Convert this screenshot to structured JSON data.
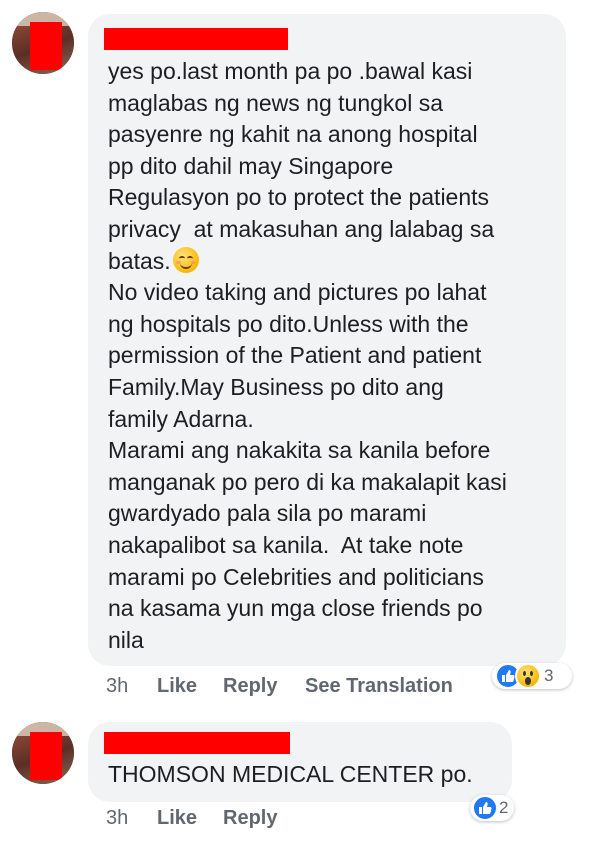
{
  "comments": [
    {
      "text_before_emoji": "yes po.last month pa po .bawal kasi\nmaglabas ng news ng tungkol sa\npasyenre ng kahit na anong hospital\npp dito dahil may Singapore\nRegulasyon po to protect the patients\nprivacy  at makasuhan ang lalabag sa\nbatas.",
      "emoji": "smiling-face-emoji",
      "text_after_emoji": "No video taking and pictures po lahat\nng hospitals po dito.Unless with the\npermission of the Patient and patient\nFamily.May Business po dito ang\nfamily Adarna.\nMarami ang nakakita sa kanila before\nmanganak po pero di ka makalapit kasi\ngwardyado pala sila po marami\nnakapalibot sa kanila.  At take note\nmarami po Celebrities and politicians\nna kasama yun mga close friends po\nnila",
      "time": "3h",
      "like_label": "Like",
      "reply_label": "Reply",
      "translation_label": "See Translation",
      "reactions": [
        "like-icon",
        "wow-icon"
      ],
      "reaction_count": "3"
    },
    {
      "text": "THOMSON MEDICAL CENTER po.",
      "time": "3h",
      "like_label": "Like",
      "reply_label": "Reply",
      "reactions": [
        "like-icon"
      ],
      "reaction_count": "2"
    }
  ],
  "colors": {
    "bubble": "#f2f3f5",
    "redaction": "#ff0000",
    "like_blue": "#2078f4",
    "meta_text": "#606770",
    "body_text": "#1c1e21"
  }
}
